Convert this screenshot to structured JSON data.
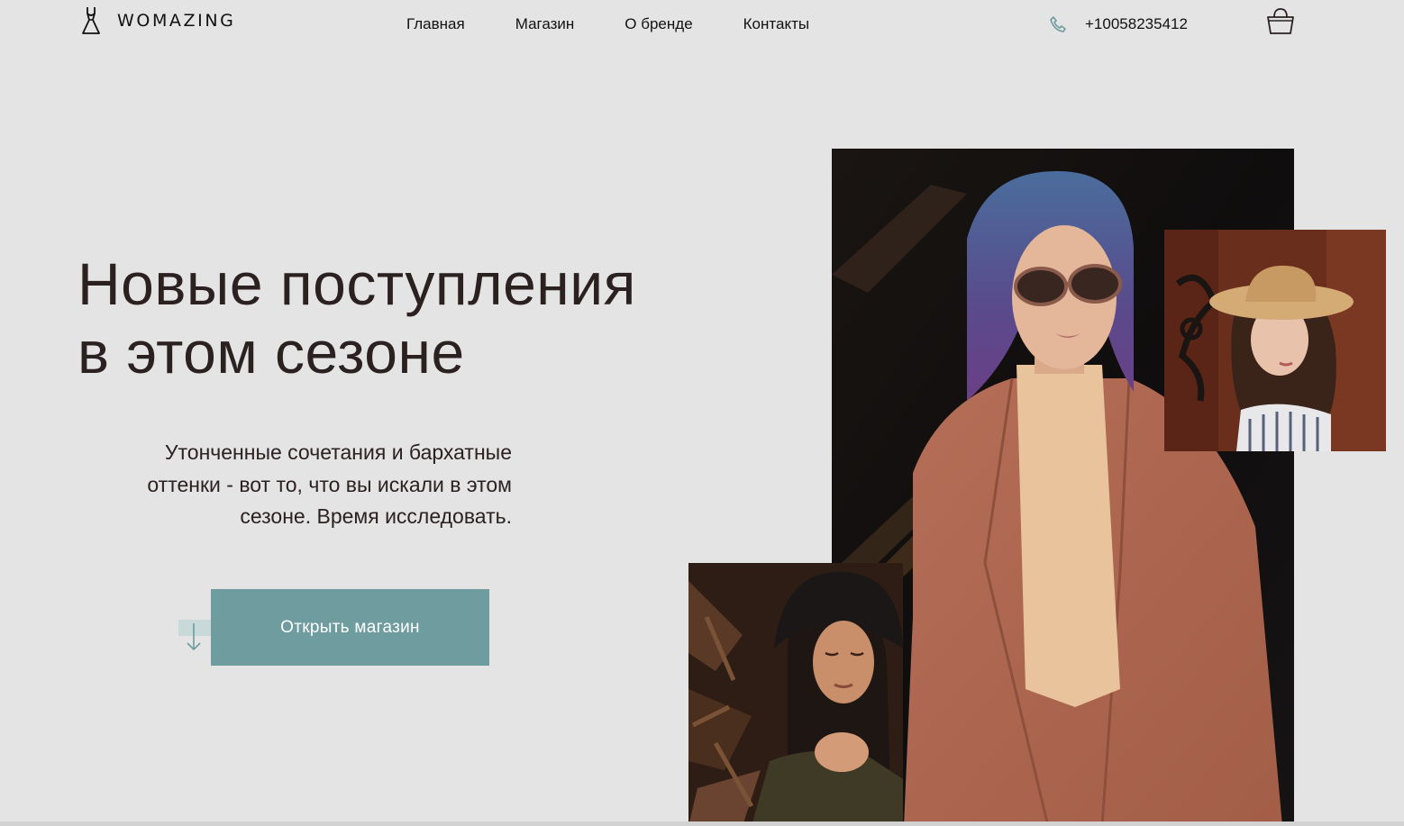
{
  "header": {
    "logo_text": "WOMAZING",
    "logo_icon": "dress-icon",
    "nav": [
      {
        "label": "Главная"
      },
      {
        "label": "Магазин"
      },
      {
        "label": "О бренде"
      },
      {
        "label": "Контакты"
      }
    ],
    "phone_icon": "phone-icon",
    "phone": "+10058235412",
    "cart_icon": "shopping-bag-icon"
  },
  "hero": {
    "title_line1": "Новые поступления",
    "title_line2": "в этом сезоне",
    "subtitle_line1": "Утонченные сочетания и бархатные",
    "subtitle_line2": "оттенки - вот то, что вы искали в этом",
    "subtitle_line3": "сезоне. Время исследовать.",
    "button_label": "Открыть магазин",
    "arrow_icon": "arrow-down-icon"
  },
  "colors": {
    "background": "#e4e4e4",
    "accent": "#6e9c9f",
    "text": "#2b2121"
  }
}
